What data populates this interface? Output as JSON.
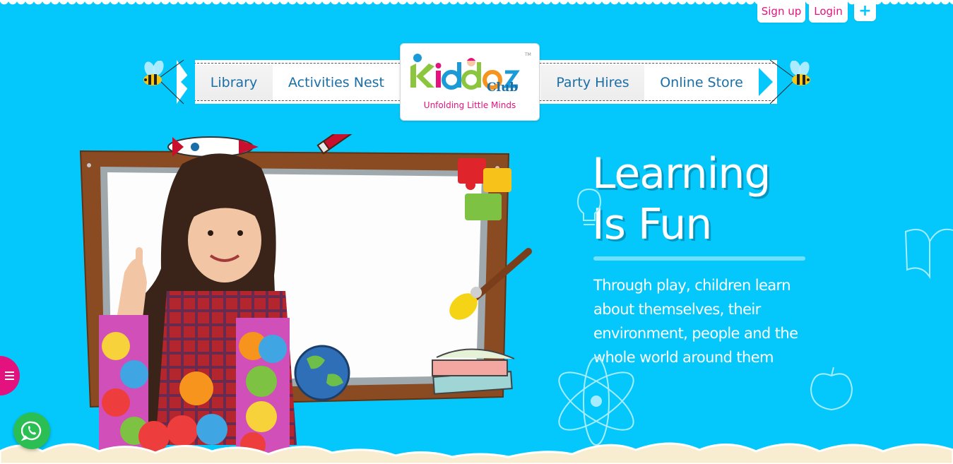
{
  "account": {
    "signup_label": "Sign up",
    "login_label": "Login",
    "plus_label": "+"
  },
  "nav": {
    "items": [
      {
        "label": "Library"
      },
      {
        "label": "Activities Nest"
      },
      {
        "label": "Party Hires"
      },
      {
        "label": "Online Store"
      }
    ]
  },
  "logo": {
    "wordmark": "Kiddoz",
    "club": "Club",
    "tagline": "Unfolding Little Minds",
    "tm": "TM"
  },
  "hero": {
    "headline_line1": "Learning",
    "headline_line2": "Is Fun",
    "description": "Through play, children learn about themselves, their environment, people and the whole world around them"
  },
  "fabs": {
    "menu_icon": "hamburger-icon",
    "whatsapp_icon": "whatsapp-icon"
  },
  "colors": {
    "background": "#04c8fb",
    "accent_pink": "#e4127e",
    "nav_text": "#1a6fa8",
    "whatsapp_green": "#2bbf53"
  }
}
